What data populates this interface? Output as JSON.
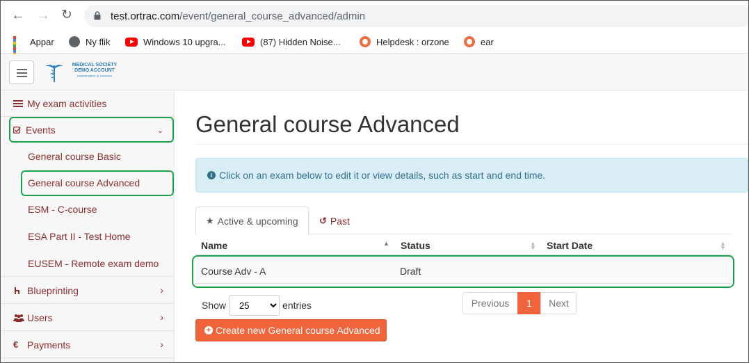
{
  "browser": {
    "url_host": "test.ortrac.com",
    "url_path": "/event/general_course_advanced/admin",
    "bookmarks": [
      {
        "label": "Appar",
        "icon": "apps-grid-icon"
      },
      {
        "label": "Ny flik",
        "icon": "globe-icon"
      },
      {
        "label": "Windows 10 upgra...",
        "icon": "youtube-icon"
      },
      {
        "label": "(87) Hidden Noise...",
        "icon": "youtube-icon"
      },
      {
        "label": "Helpdesk : orzone",
        "icon": "orzone-icon"
      },
      {
        "label": "ear",
        "icon": "orzone-icon"
      }
    ]
  },
  "logo": {
    "line1": "MEDICAL SOCIETY",
    "line2": "DEMO ACCOUNT",
    "line3": "examination & courses"
  },
  "sidebar": {
    "items": [
      {
        "label": "My exam activities",
        "icon": "list-icon"
      },
      {
        "label": "Events",
        "icon": "checkbox-icon",
        "expanded": true
      },
      {
        "label": "Blueprinting",
        "icon": "sitemap-icon"
      },
      {
        "label": "Users",
        "icon": "users-icon"
      },
      {
        "label": "Payments",
        "icon": "euro-icon"
      }
    ],
    "events_sub": [
      "General course Basic",
      "General course Advanced",
      "ESM - C-course",
      "ESA Part II - Test Home",
      "EUSEM - Remote exam demo"
    ]
  },
  "main": {
    "title": "General course Advanced",
    "alert": "Click on an exam below to edit it or view details, such as start and end time.",
    "tabs": [
      {
        "label": "Active & upcoming",
        "icon": "star-icon",
        "active": true
      },
      {
        "label": "Past",
        "icon": "history-icon",
        "active": false
      }
    ],
    "table": {
      "columns": [
        "Name",
        "Status",
        "Start Date"
      ],
      "rows": [
        {
          "name": "Course Adv - A",
          "status": "Draft",
          "start_date": ""
        }
      ]
    },
    "show_label": "Show",
    "entries_value": "25",
    "entries_label": "entries",
    "pager": {
      "prev": "Previous",
      "current": "1",
      "next": "Next"
    },
    "create_button": "Create new General course Advanced"
  },
  "colors": {
    "accent": "#f0643c",
    "link": "#8b2e2e",
    "highlight": "#1aa34a",
    "alert_bg": "#d9edf7"
  }
}
